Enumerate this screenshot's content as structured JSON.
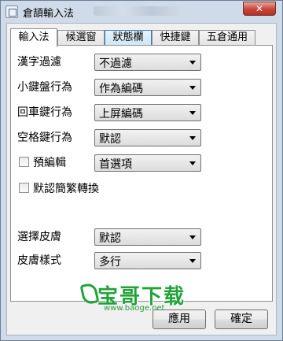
{
  "window": {
    "title": "倉頡輸入法",
    "close_label": "✕"
  },
  "tabs": [
    {
      "label": "輸入法",
      "active": true
    },
    {
      "label": "候選窗",
      "active": false
    },
    {
      "label": "狀態欄",
      "active": false
    },
    {
      "label": "快捷鍵",
      "active": false
    },
    {
      "label": "五倉通用",
      "active": false
    }
  ],
  "settings": {
    "hanzi_filter": {
      "label": "漢字過濾",
      "value": "不過濾"
    },
    "small_keyboard": {
      "label": "小鍵盤行為",
      "value": "作為編碼"
    },
    "enter_key": {
      "label": "回車鍵行為",
      "value": "上屏編碼"
    },
    "space_key": {
      "label": "空格鍵行為",
      "value": "默認"
    },
    "pre_edit": {
      "label": "預編輯",
      "value": "首選項",
      "checked": false
    },
    "trad_simp": {
      "label": "默認簡繁轉換",
      "checked": false
    },
    "skin": {
      "label": "選擇皮膚",
      "value": "默認"
    },
    "skin_style": {
      "label": "皮膚樣式",
      "value": "多行"
    }
  },
  "buttons": {
    "apply": "應用",
    "ok": "確定"
  },
  "watermark": {
    "text": "宝哥下载",
    "url": "www.baoge.net"
  }
}
